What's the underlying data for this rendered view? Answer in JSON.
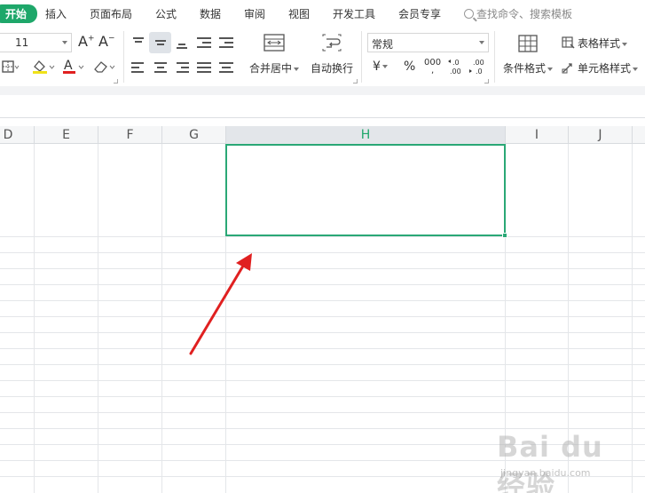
{
  "menu": {
    "tabs": [
      "开始",
      "插入",
      "页面布局",
      "公式",
      "数据",
      "审阅",
      "视图",
      "开发工具",
      "会员专享"
    ],
    "search_placeholder": "查找命令、搜索模板"
  },
  "ribbon": {
    "font_size": "11",
    "number_format": "常规",
    "merge_center": "合并居中",
    "wrap_text": "自动换行",
    "currency": "¥",
    "percent": "%",
    "thousands": "000",
    "conditional_format": "条件格式",
    "table_style": "表格样式",
    "cell_style": "单元格样式"
  },
  "grid": {
    "columns": [
      "D",
      "E",
      "F",
      "G",
      "H",
      "I",
      "J"
    ],
    "selected_column": "H"
  },
  "watermark": {
    "brand": "Bai du 经验",
    "url": "jingyan.baidu.com"
  },
  "colors": {
    "accent": "#1ea76a",
    "selection": "#2aa876",
    "arrow": "#e02020"
  }
}
